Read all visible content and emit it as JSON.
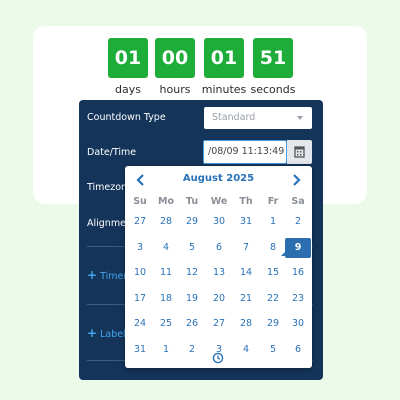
{
  "countdown": {
    "units": [
      {
        "value": "01",
        "label": "days"
      },
      {
        "value": "00",
        "label": "hours"
      },
      {
        "value": "01",
        "label": "minutes"
      },
      {
        "value": "51",
        "label": "seconds"
      }
    ],
    "accent_color": "#1fad3a"
  },
  "settings": {
    "countdown_type_label": "Countdown Type",
    "countdown_type_value": "Standard",
    "datetime_label": "Date/Time",
    "datetime_value": "/08/09 11:13:49",
    "timezone_label": "Timezone",
    "alignment_label": "Alignment",
    "timer_section_label": "Timer",
    "labels_section_label": "Labels",
    "panel_color": "#14345a"
  },
  "datepicker": {
    "month_title": "August 2025",
    "weekdays": [
      "Su",
      "Mo",
      "Tu",
      "We",
      "Th",
      "Fr",
      "Sa"
    ],
    "weeks": [
      [
        {
          "d": "27",
          "o": true
        },
        {
          "d": "28",
          "o": true
        },
        {
          "d": "29",
          "o": true
        },
        {
          "d": "30",
          "o": true
        },
        {
          "d": "31",
          "o": true
        },
        {
          "d": "1"
        },
        {
          "d": "2"
        }
      ],
      [
        {
          "d": "3"
        },
        {
          "d": "4"
        },
        {
          "d": "5"
        },
        {
          "d": "6"
        },
        {
          "d": "7"
        },
        {
          "d": "8",
          "today": true
        },
        {
          "d": "9",
          "sel": true
        }
      ],
      [
        {
          "d": "10"
        },
        {
          "d": "11"
        },
        {
          "d": "12"
        },
        {
          "d": "13"
        },
        {
          "d": "14"
        },
        {
          "d": "15"
        },
        {
          "d": "16"
        }
      ],
      [
        {
          "d": "17"
        },
        {
          "d": "18"
        },
        {
          "d": "19"
        },
        {
          "d": "20"
        },
        {
          "d": "21"
        },
        {
          "d": "22"
        },
        {
          "d": "23"
        }
      ],
      [
        {
          "d": "24"
        },
        {
          "d": "25"
        },
        {
          "d": "26"
        },
        {
          "d": "27"
        },
        {
          "d": "28"
        },
        {
          "d": "29"
        },
        {
          "d": "30"
        }
      ],
      [
        {
          "d": "31"
        },
        {
          "d": "1",
          "o": true
        },
        {
          "d": "2",
          "o": true
        },
        {
          "d": "3",
          "o": true
        },
        {
          "d": "4",
          "o": true
        },
        {
          "d": "5",
          "o": true
        },
        {
          "d": "6",
          "o": true
        }
      ]
    ],
    "selected_color": "#2b6fb0"
  }
}
